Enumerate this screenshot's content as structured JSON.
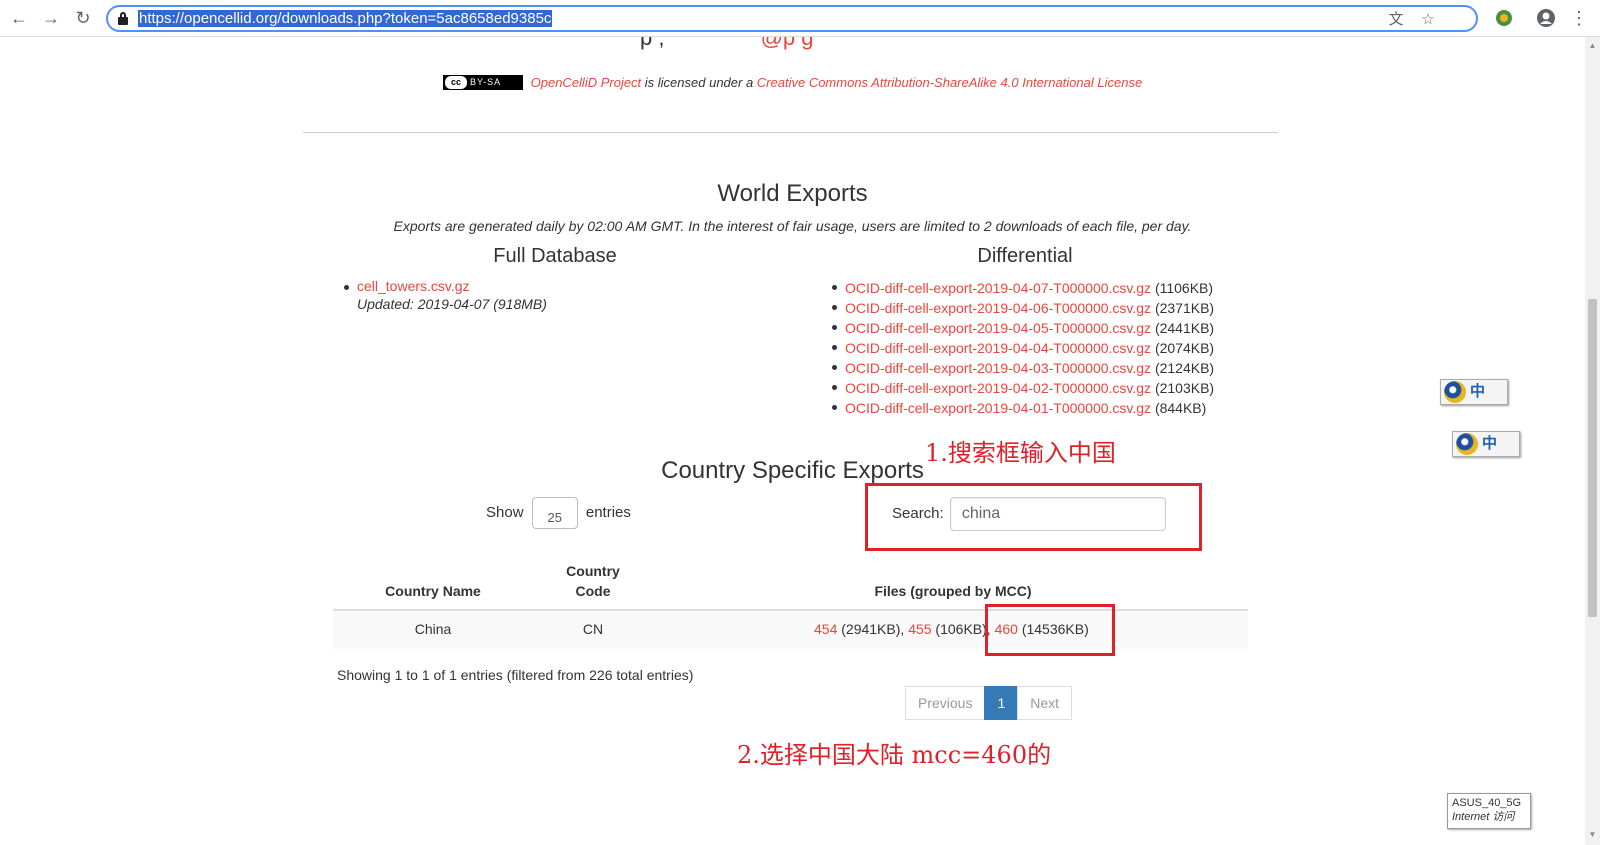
{
  "browser": {
    "url": "https://opencellid.org/downloads.php?token=5ac8658ed9385c",
    "back_icon": "←",
    "forward_icon": "→",
    "reload_icon": "↻",
    "translate_icon": "文",
    "star_icon": "☆",
    "menu_icon": "⋮"
  },
  "page": {
    "top_partial_left": "p  ,",
    "top_partial_right": "@p  g",
    "license": {
      "badge_cc": "cc",
      "badge_by": "BY-SA",
      "project": "OpenCelliD Project",
      "middle": " is licensed under a ",
      "license_name": "Creative Commons Attribution-ShareAlike 4.0 International License"
    },
    "world_exports": {
      "title": "World Exports",
      "note": "Exports are generated daily by 02:00 AM GMT. In the interest of fair usage, users are limited to 2 downloads of each file, per day."
    },
    "full_database": {
      "title": "Full Database",
      "file": "cell_towers.csv.gz",
      "updated": "Updated: 2019-04-07 (918MB)"
    },
    "differential": {
      "title": "Differential",
      "files": [
        {
          "name": "OCID-diff-cell-export-2019-04-07-T000000.csv.gz",
          "size": " (1106KB)"
        },
        {
          "name": "OCID-diff-cell-export-2019-04-06-T000000.csv.gz",
          "size": " (2371KB)"
        },
        {
          "name": "OCID-diff-cell-export-2019-04-05-T000000.csv.gz",
          "size": " (2441KB)"
        },
        {
          "name": "OCID-diff-cell-export-2019-04-04-T000000.csv.gz",
          "size": " (2074KB)"
        },
        {
          "name": "OCID-diff-cell-export-2019-04-03-T000000.csv.gz",
          "size": " (2124KB)"
        },
        {
          "name": "OCID-diff-cell-export-2019-04-02-T000000.csv.gz",
          "size": " (2103KB)"
        },
        {
          "name": "OCID-diff-cell-export-2019-04-01-T000000.csv.gz",
          "size": " (844KB)"
        }
      ]
    },
    "country": {
      "title": "Country Specific Exports",
      "show_label": "Show",
      "show_value": "25",
      "entries_label": "entries",
      "search_label": "Search:",
      "search_value": "china",
      "columns": [
        "Country Name",
        "Country Code",
        "Files (grouped by MCC)"
      ],
      "row": {
        "name": "China",
        "code": "CN",
        "files": [
          {
            "mcc": "454",
            "size": " (2941KB), "
          },
          {
            "mcc": "455",
            "size": " (106KB), "
          },
          {
            "mcc": "460",
            "size": " (14536KB)"
          }
        ]
      },
      "showing": "Showing 1 to 1 of 1 entries (filtered from 226 total entries)",
      "pager": {
        "previous": "Previous",
        "current": "1",
        "next": "Next"
      }
    },
    "annotations": {
      "step1": "1.搜索框输入中国",
      "step2": "2.选择中国大陆 mcc=460的"
    }
  },
  "overlays": {
    "ime_char": "中",
    "wifi_name": "ASUS_40_5G",
    "wifi_status": "Internet 访问"
  },
  "colors": {
    "link": "#e8473d",
    "annotation": "#e0202a",
    "pager_active": "#337ab7",
    "url_highlight": "#3367d6"
  }
}
